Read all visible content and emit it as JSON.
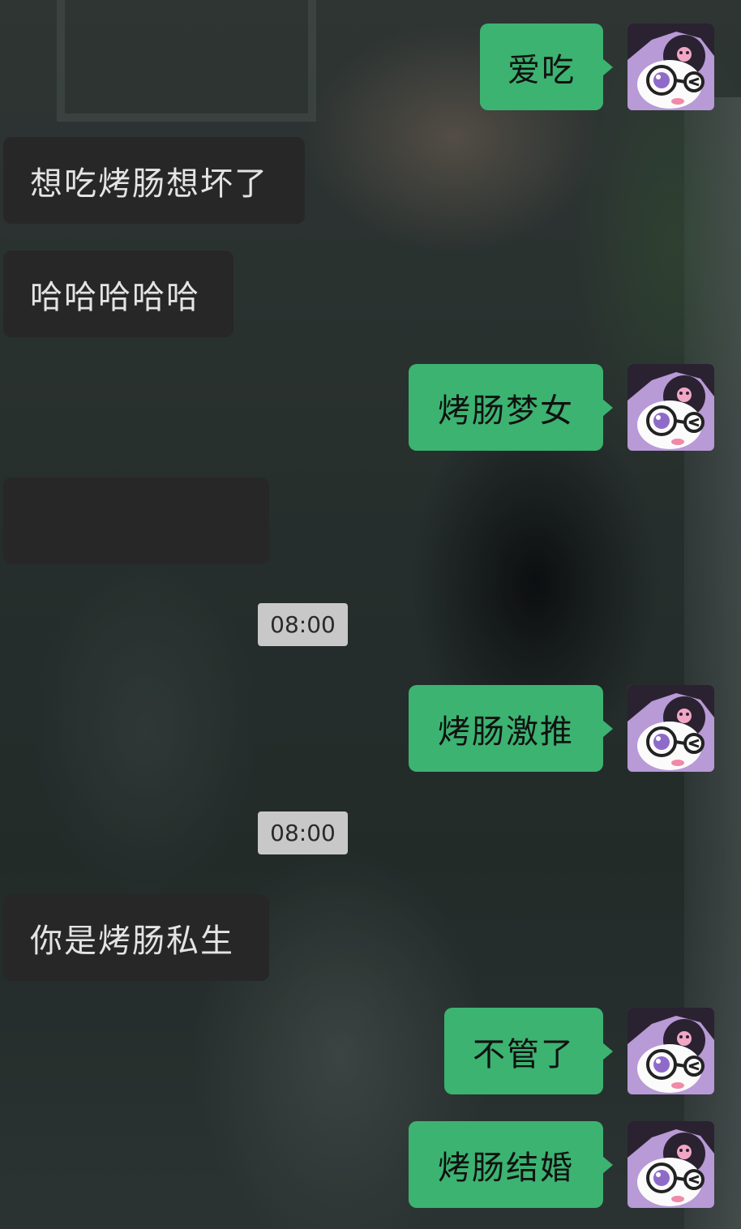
{
  "chat": {
    "messages": [
      {
        "side": "out",
        "text": "爱吃"
      },
      {
        "side": "in",
        "text": "想吃烤肠想坏了"
      },
      {
        "side": "in",
        "text": "哈哈哈哈哈"
      },
      {
        "side": "out",
        "text": "烤肠梦女"
      },
      {
        "side": "in",
        "text": ""
      },
      {
        "type": "timestamp",
        "text": "08:00"
      },
      {
        "side": "out",
        "text": "烤肠激推"
      },
      {
        "type": "timestamp",
        "text": "08:00"
      },
      {
        "side": "in",
        "text": "你是烤肠私生"
      },
      {
        "side": "out",
        "text": "不管了"
      },
      {
        "side": "out",
        "text": "烤肠结婚"
      }
    ]
  },
  "colors": {
    "outgoing_bubble": "#3cb371",
    "incoming_bubble": "#272727",
    "timestamp_bg": "#c8c8c8"
  },
  "icons": {
    "avatar": "kuromi-avatar-icon"
  }
}
